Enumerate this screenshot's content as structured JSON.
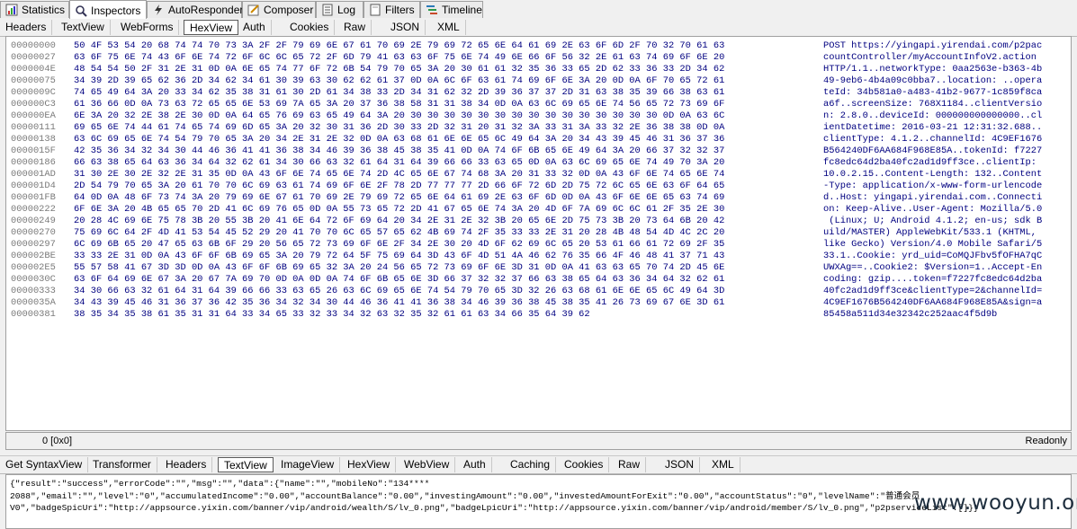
{
  "top_tabs": [
    {
      "label": "Statistics",
      "icon": "statistics-icon"
    },
    {
      "label": "Inspectors",
      "icon": "inspectors-icon"
    },
    {
      "label": "AutoResponder",
      "icon": "lightning-icon"
    },
    {
      "label": "Composer",
      "icon": "composer-icon"
    },
    {
      "label": "Log",
      "icon": "log-icon"
    },
    {
      "label": "Filters",
      "icon": "filters-icon"
    },
    {
      "label": "Timeline",
      "icon": "timeline-icon"
    }
  ],
  "request_tabs": [
    "Headers",
    "TextView",
    "WebForms",
    "HexView",
    "Auth",
    "Cookies",
    "Raw",
    "JSON",
    "XML"
  ],
  "hex": {
    "offsets": "00000000\n00000027\n0000004E\n00000075\n0000009C\n000000C3\n000000EA\n00000111\n00000138\n0000015F\n00000186\n000001AD\n000001D4\n000001FB\n00000222\n00000249\n00000270\n00000297\n000002BE\n000002E5\n0000030C\n00000333\n0000035A\n00000381",
    "bytes": "50 4F 53 54 20 68 74 74 70 73 3A 2F 2F 79 69 6E 67 61 70 69 2E 79 69 72 65 6E 64 61 69 2E 63 6F 6D 2F 70 32 70 61 63\n63 6F 75 6E 74 43 6F 6E 74 72 6F 6C 6C 65 72 2F 6D 79 41 63 63 6F 75 6E 74 49 6E 66 6F 56 32 2E 61 63 74 69 6F 6E 20\n48 54 54 50 2F 31 2E 31 0D 0A 6E 65 74 77 6F 72 6B 54 79 70 65 3A 20 30 61 61 32 35 36 33 65 2D 62 33 36 33 2D 34 62\n34 39 2D 39 65 62 36 2D 34 62 34 61 30 39 63 30 62 62 61 37 0D 0A 6C 6F 63 61 74 69 6F 6E 3A 20 0D 0A 6F 70 65 72 61\n74 65 49 64 3A 20 33 34 62 35 38 31 61 30 2D 61 34 38 33 2D 34 31 62 32 2D 39 36 37 37 2D 31 63 38 35 39 66 38 63 61\n61 36 66 0D 0A 73 63 72 65 65 6E 53 69 7A 65 3A 20 37 36 38 58 31 31 38 34 0D 0A 63 6C 69 65 6E 74 56 65 72 73 69 6F\n6E 3A 20 32 2E 38 2E 30 0D 0A 64 65 76 69 63 65 49 64 3A 20 30 30 30 30 30 30 30 30 30 30 30 30 30 30 30 0D 0A 63 6C\n69 65 6E 74 44 61 74 65 74 69 6D 65 3A 20 32 30 31 36 2D 30 33 2D 32 31 20 31 32 3A 33 31 3A 33 32 2E 36 38 38 0D 0A\n63 6C 69 65 6E 74 54 79 70 65 3A 20 34 2E 31 2E 32 0D 0A 63 68 61 6E 6E 65 6C 49 64 3A 20 34 43 39 45 46 31 36 37 36\n42 35 36 34 32 34 30 44 46 36 41 41 36 38 34 46 39 36 38 45 38 35 41 0D 0A 74 6F 6B 65 6E 49 64 3A 20 66 37 32 32 37\n66 63 38 65 64 63 36 34 64 32 62 61 34 30 66 63 32 61 64 31 64 39 66 66 33 63 65 0D 0A 63 6C 69 65 6E 74 49 70 3A 20\n31 30 2E 30 2E 32 2E 31 35 0D 0A 43 6F 6E 74 65 6E 74 2D 4C 65 6E 67 74 68 3A 20 31 33 32 0D 0A 43 6F 6E 74 65 6E 74\n2D 54 79 70 65 3A 20 61 70 70 6C 69 63 61 74 69 6F 6E 2F 78 2D 77 77 77 2D 66 6F 72 6D 2D 75 72 6C 65 6E 63 6F 64 65\n64 0D 0A 48 6F 73 74 3A 20 79 69 6E 67 61 70 69 2E 79 69 72 65 6E 64 61 69 2E 63 6F 6D 0D 0A 43 6F 6E 6E 65 63 74 69\n6F 6E 3A 20 4B 65 65 70 2D 41 6C 69 76 65 0D 0A 55 73 65 72 2D 41 67 65 6E 74 3A 20 4D 6F 7A 69 6C 6C 61 2F 35 2E 30\n20 28 4C 69 6E 75 78 3B 20 55 3B 20 41 6E 64 72 6F 69 64 20 34 2E 31 2E 32 3B 20 65 6E 2D 75 73 3B 20 73 64 6B 20 42\n75 69 6C 64 2F 4D 41 53 54 45 52 29 20 41 70 70 6C 65 57 65 62 4B 69 74 2F 35 33 33 2E 31 20 28 4B 48 54 4D 4C 2C 20\n6C 69 6B 65 20 47 65 63 6B 6F 29 20 56 65 72 73 69 6F 6E 2F 34 2E 30 20 4D 6F 62 69 6C 65 20 53 61 66 61 72 69 2F 35\n33 33 2E 31 0D 0A 43 6F 6F 6B 69 65 3A 20 79 72 64 5F 75 69 64 3D 43 6F 4D 51 4A 46 62 76 35 66 4F 46 48 41 37 71 43\n55 57 58 41 67 3D 3D 0D 0A 43 6F 6F 6B 69 65 32 3A 20 24 56 65 72 73 69 6F 6E 3D 31 0D 0A 41 63 63 65 70 74 2D 45 6E\n63 6F 64 69 6E 67 3A 20 67 7A 69 70 0D 0A 0D 0A 74 6F 6B 65 6E 3D 66 37 32 32 37 66 63 38 65 64 63 36 34 64 32 62 61\n34 30 66 63 32 61 64 31 64 39 66 66 33 63 65 26 63 6C 69 65 6E 74 54 79 70 65 3D 32 26 63 68 61 6E 6E 65 6C 49 64 3D\n34 43 39 45 46 31 36 37 36 42 35 36 34 32 34 30 44 46 36 41 41 36 38 34 46 39 36 38 45 38 35 41 26 73 69 67 6E 3D 61\n38 35 34 35 38 61 35 31 31 64 33 34 65 33 32 33 34 32 63 32 35 32 61 61 63 34 66 35 64 39 62",
    "ascii": "POST https://yingapi.yirendai.com/p2pac\ncountController/myAccountInfoV2.action \nHTTP/1.1..networkType: 0aa2563e-b363-4b\n49-9eb6-4b4a09c0bba7..location: ..opera\nteId: 34b581a0-a483-41b2-9677-1c859f8ca\na6f..screenSize: 768X1184..clientVersio\nn: 2.8.0..deviceId: 000000000000000..cl\nientDatetime: 2016-03-21 12:31:32.688..\nclientType: 4.1.2..channelId: 4C9EF1676\nB564240DF6AA684F968E85A..tokenId: f7227\nfc8edc64d2ba40fc2ad1d9ff3ce..clientIp: \n10.0.2.15..Content-Length: 132..Content\n-Type: application/x-www-form-urlencode\nd..Host: yingapi.yirendai.com..Connecti\non: Keep-Alive..User-Agent: Mozilla/5.0\n (Linux; U; Android 4.1.2; en-us; sdk B\nuild/MASTER) AppleWebKit/533.1 (KHTML, \nlike Gecko) Version/4.0 Mobile Safari/5\n33.1..Cookie: yrd_uid=CoMQJFbv5fOFHA7qC\nUWXAg==..Cookie2: $Version=1..Accept-En\ncoding: gzip....token=f7227fc8edc64d2ba\n40fc2ad1d9ff3ce&clientType=2&channelId=\n4C9EF1676B564240DF6AA684F968E85A&sign=a\n85458a511d34e32342c252aac4f5d9b"
  },
  "request_status": {
    "position": "0 [0x0]",
    "mode": "Readonly"
  },
  "response_tabs": [
    "Get SyntaxView",
    "Transformer",
    "Headers",
    "TextView",
    "ImageView",
    "HexView",
    "WebView",
    "Auth",
    "Caching",
    "Cookies",
    "Raw",
    "JSON",
    "XML"
  ],
  "response_text": "{\"result\":\"success\",\"errorCode\":\"\",\"msg\":\"\",\"data\":{\"name\":\"\",\"mobileNo\":\"134****\n2088\",\"email\":\"\",\"level\":\"0\",\"accumulatedIncome\":\"0.00\",\"accountBalance\":\"0.00\",\"investingAmount\":\"0.00\",\"investedAmountForExit\":\"0.00\",\"accountStatus\":\"0\",\"levelName\":\"普通会员\nV0\",\"badgeSpicUri\":\"http://appsource.yixin.com/banner/vip/android/wealth/S/lv_0.png\",\"badgeLpicUri\":\"http://appsource.yixin.com/banner/vip/android/member/S/lv_0.png\",\"p2pserviceList\":[]}}",
  "watermark": "www.wooyun.org"
}
